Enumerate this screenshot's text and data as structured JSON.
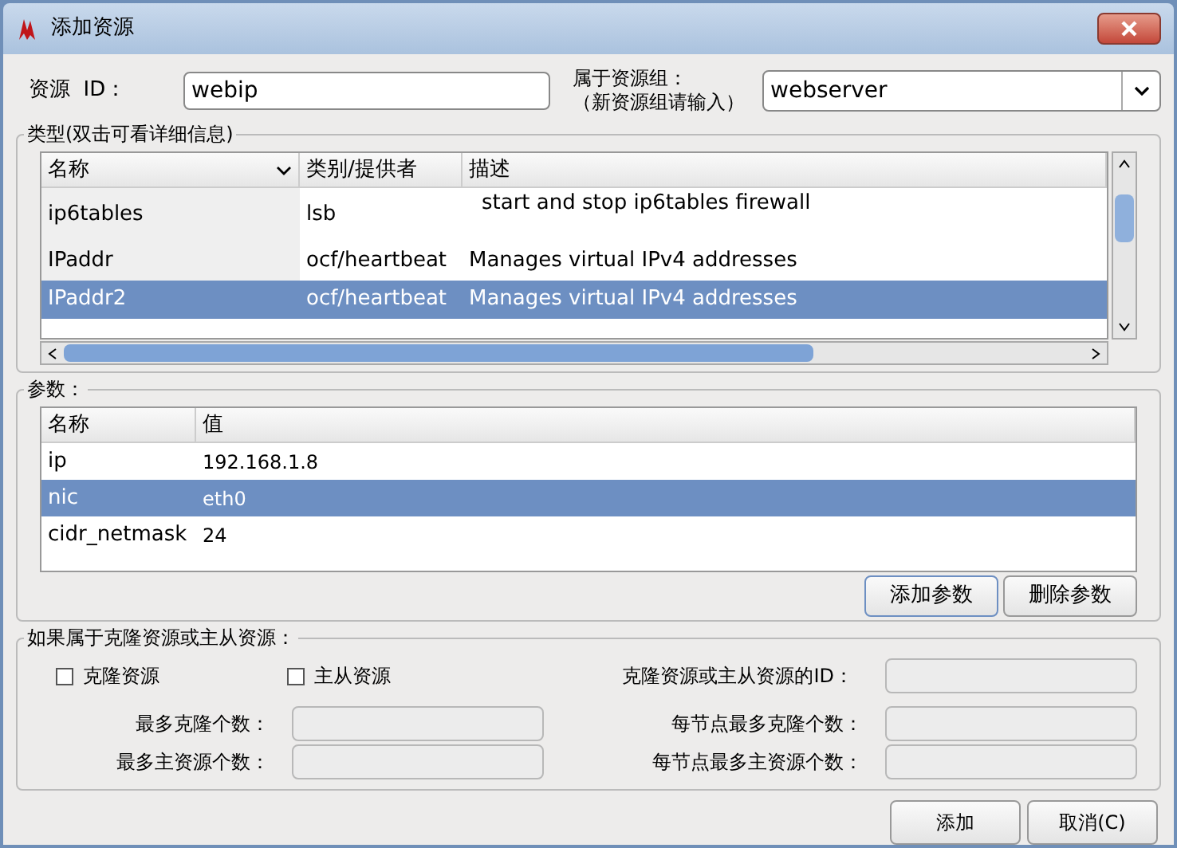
{
  "window": {
    "title": "添加资源"
  },
  "resource_id": {
    "label": "资源  ID：",
    "value": "webip"
  },
  "group": {
    "label": "属于资源组：",
    "hint": "（新资源组请输入）",
    "value": "webserver"
  },
  "types": {
    "legend": "类型(双击可看详细信息)",
    "columns": [
      "名称",
      "类别/提供者",
      "描述"
    ],
    "rows": [
      {
        "name": "ip6tables",
        "provider": "lsb",
        "description": "start and stop ip6tables firewall",
        "selected": false
      },
      {
        "name": "IPaddr",
        "provider": "ocf/heartbeat",
        "description": "Manages virtual IPv4 addresses",
        "selected": false
      },
      {
        "name": "IPaddr2",
        "provider": "ocf/heartbeat",
        "description": "Manages virtual IPv4 addresses",
        "selected": true
      }
    ]
  },
  "params": {
    "legend": "参数：",
    "columns": [
      "名称",
      "值"
    ],
    "rows": [
      {
        "name": "ip",
        "value": "192.168.1.8",
        "selected": false
      },
      {
        "name": "nic",
        "value": "eth0",
        "selected": true
      },
      {
        "name": "cidr_netmask",
        "value": "24",
        "selected": false
      }
    ],
    "buttons": [
      {
        "label": "添加参数",
        "focused": true
      },
      {
        "label": "删除参数",
        "focused": false
      }
    ]
  },
  "clone": {
    "legend": "如果属于克隆资源或主从资源：",
    "checkboxes": [
      {
        "label": "克隆资源",
        "checked": false
      },
      {
        "label": "主从资源",
        "checked": false
      }
    ],
    "id_label": "克隆资源或主从资源的ID：",
    "fields": [
      {
        "label": "最多克隆个数："
      },
      {
        "label": "每节点最多克隆个数："
      },
      {
        "label": "最多主资源个数："
      },
      {
        "label": "每节点最多主资源个数："
      }
    ]
  },
  "footer": {
    "buttons": [
      "添加",
      "取消(C)"
    ]
  }
}
